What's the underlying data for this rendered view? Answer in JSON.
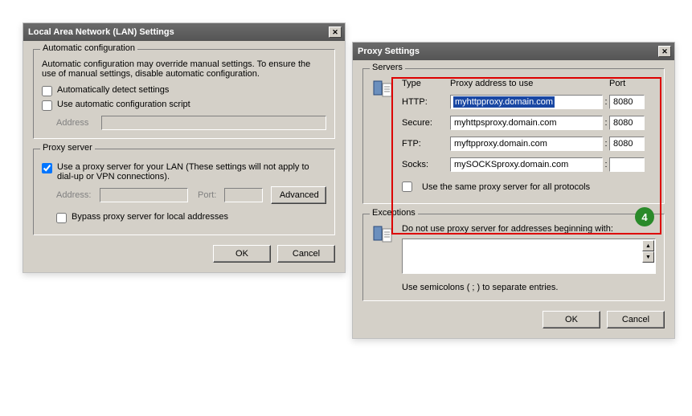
{
  "lan": {
    "title": "Local Area Network (LAN) Settings",
    "autoconf": {
      "legend": "Automatic configuration",
      "desc": "Automatic configuration may override manual settings.  To ensure the use of manual settings, disable automatic configuration.",
      "auto_detect_label": "Automatically detect settings",
      "use_script_label": "Use automatic configuration script",
      "address_label": "Address"
    },
    "proxy": {
      "legend": "Proxy server",
      "use_label": "Use a proxy server for your LAN (These settings will not apply to dial-up or VPN connections).",
      "address_label": "Address:",
      "port_label": "Port:",
      "advanced_label": "Advanced",
      "bypass_label": "Bypass proxy server for local addresses"
    },
    "ok_label": "OK",
    "cancel_label": "Cancel"
  },
  "proxy_settings": {
    "title": "Proxy Settings",
    "servers": {
      "legend": "Servers",
      "type_header": "Type",
      "addr_header": "Proxy address to use",
      "port_header": "Port",
      "rows": {
        "http": {
          "label": "HTTP:",
          "address": "myhttpproxy.domain.com",
          "port": "8080"
        },
        "secure": {
          "label": "Secure:",
          "address": "myhttpsproxy.domain.com",
          "port": "8080"
        },
        "ftp": {
          "label": "FTP:",
          "address": "myftpproxy.domain.com",
          "port": "8080"
        },
        "socks": {
          "label": "Socks:",
          "address": "mySOCKSproxy.domain.com",
          "port": ""
        }
      },
      "same_label": "Use the same proxy server for all protocols"
    },
    "exceptions": {
      "legend": "Exceptions",
      "desc": "Do not use proxy server for addresses beginning with:",
      "hint": "Use semicolons ( ; ) to separate entries.",
      "value": ""
    },
    "ok_label": "OK",
    "cancel_label": "Cancel"
  },
  "annotation": {
    "badge": "4"
  }
}
